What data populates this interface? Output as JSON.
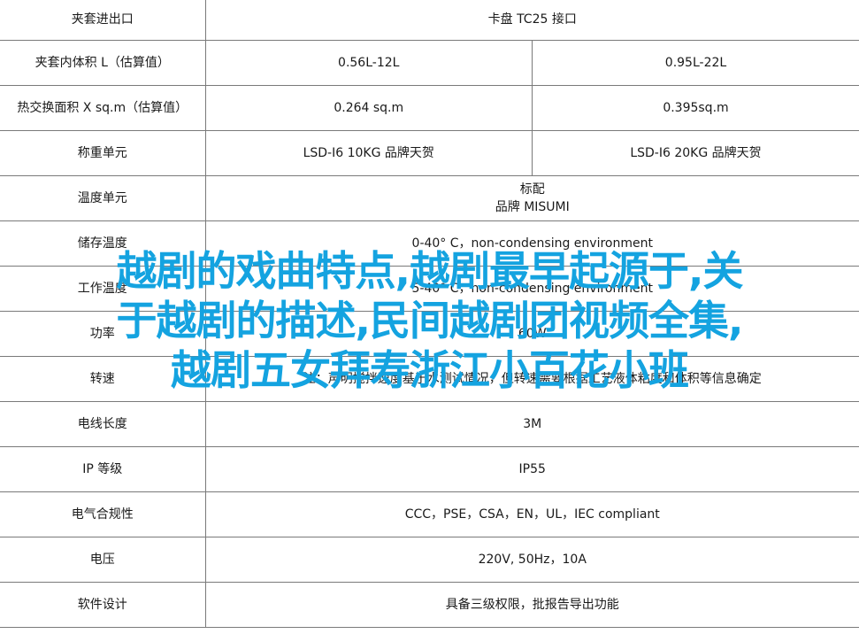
{
  "table": {
    "rows": [
      {
        "label": "夹套进出口",
        "span": "卡盘 TC25 接口"
      },
      {
        "label": "夹套内体积 L（估算值）",
        "v1": "0.56L-12L",
        "v2": "0.95L-22L"
      },
      {
        "label": "热交换面积 X sq.m（估算值）",
        "v1": "0.264 sq.m",
        "v2": "0.395sq.m"
      },
      {
        "label": "称重单元",
        "v1": "LSD-I6 10KG 品牌天贺",
        "v2": "LSD-I6 20KG 品牌天贺"
      },
      {
        "label": "温度单元",
        "span_lines": [
          "标配",
          "品牌 MISUMI"
        ]
      },
      {
        "label": "储存温度",
        "span": "0-40° C，non-condensing environment"
      },
      {
        "label": "工作温度",
        "span": "5-40° C，non-condensing environment"
      },
      {
        "label": "功率",
        "span": "60W"
      },
      {
        "label": "转速",
        "span": "注：声明搅拌速度基于水测试情况，但转速需要根据工艺液体粘度和体积等信息确定"
      },
      {
        "label": "电线长度",
        "span": "3M"
      },
      {
        "label": "IP 等级",
        "span": "IP55"
      },
      {
        "label": "电气合规性",
        "span": "CCC，PSE，CSA，EN，UL，IEC compliant"
      },
      {
        "label": "电压",
        "span": "220V, 50Hz，10A"
      },
      {
        "label": "软件设计",
        "span": "具备三级权限，批报告导出功能"
      }
    ]
  },
  "overlay": {
    "lines": [
      "越剧的戏曲特点,越剧最早起源于,关",
      "于越剧的描述,民间越剧团视频全集,",
      "越剧五女拜寿浙江小百花小班"
    ],
    "color": "#14a3e0"
  }
}
